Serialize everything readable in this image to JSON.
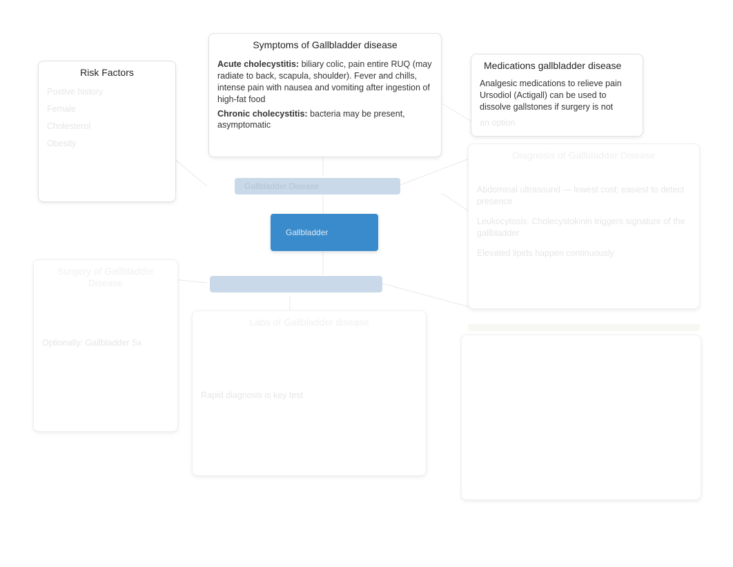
{
  "risk_factors": {
    "title": "Risk Factors",
    "items": [
      "Postive history",
      "Female",
      "Cholesterol",
      "Obesity"
    ]
  },
  "symptoms": {
    "title": "Symptoms of Gallbladder disease",
    "acute_label": "Acute cholecystitis:",
    "acute_text": " biliary colic, pain entire RUQ (may radiate to back, scapula, shoulder). Fever and chills, intense pain with nausea and vomiting after ingestion of high-fat food",
    "chronic_label": "Chronic cholecystitis:",
    "chronic_text": " bacteria may be present, asymptomatic"
  },
  "center": {
    "top_pill": "Gallbladder Disease",
    "main_pill": "Gallbladder",
    "bottom_pill": ""
  },
  "surgery": {
    "title": "Surgery of Gallbladder Disease",
    "body_1": "Optionally: Gallbladder Sx"
  },
  "labs": {
    "title": "Labs of Gallbladder disease",
    "body_1": "Rapid diagnosis is key test"
  },
  "medications": {
    "title": "Medications gallbladder disease",
    "line1": "Analgesic medications to relieve pain",
    "line2": "Ursodiol (Actigall) can be used to dissolve gallstones if surgery is not",
    "line3": "an option"
  },
  "diagnosis": {
    "title": "Diagnosis of Gallbladder Disease",
    "line1": "Abdominal ultrasound — lowest cost; easiest to detect presence",
    "line2": "Leukocytosis: Cholecystokinin triggers signature of the gallbladder",
    "line3": "Elevated lipids happen continuously"
  }
}
